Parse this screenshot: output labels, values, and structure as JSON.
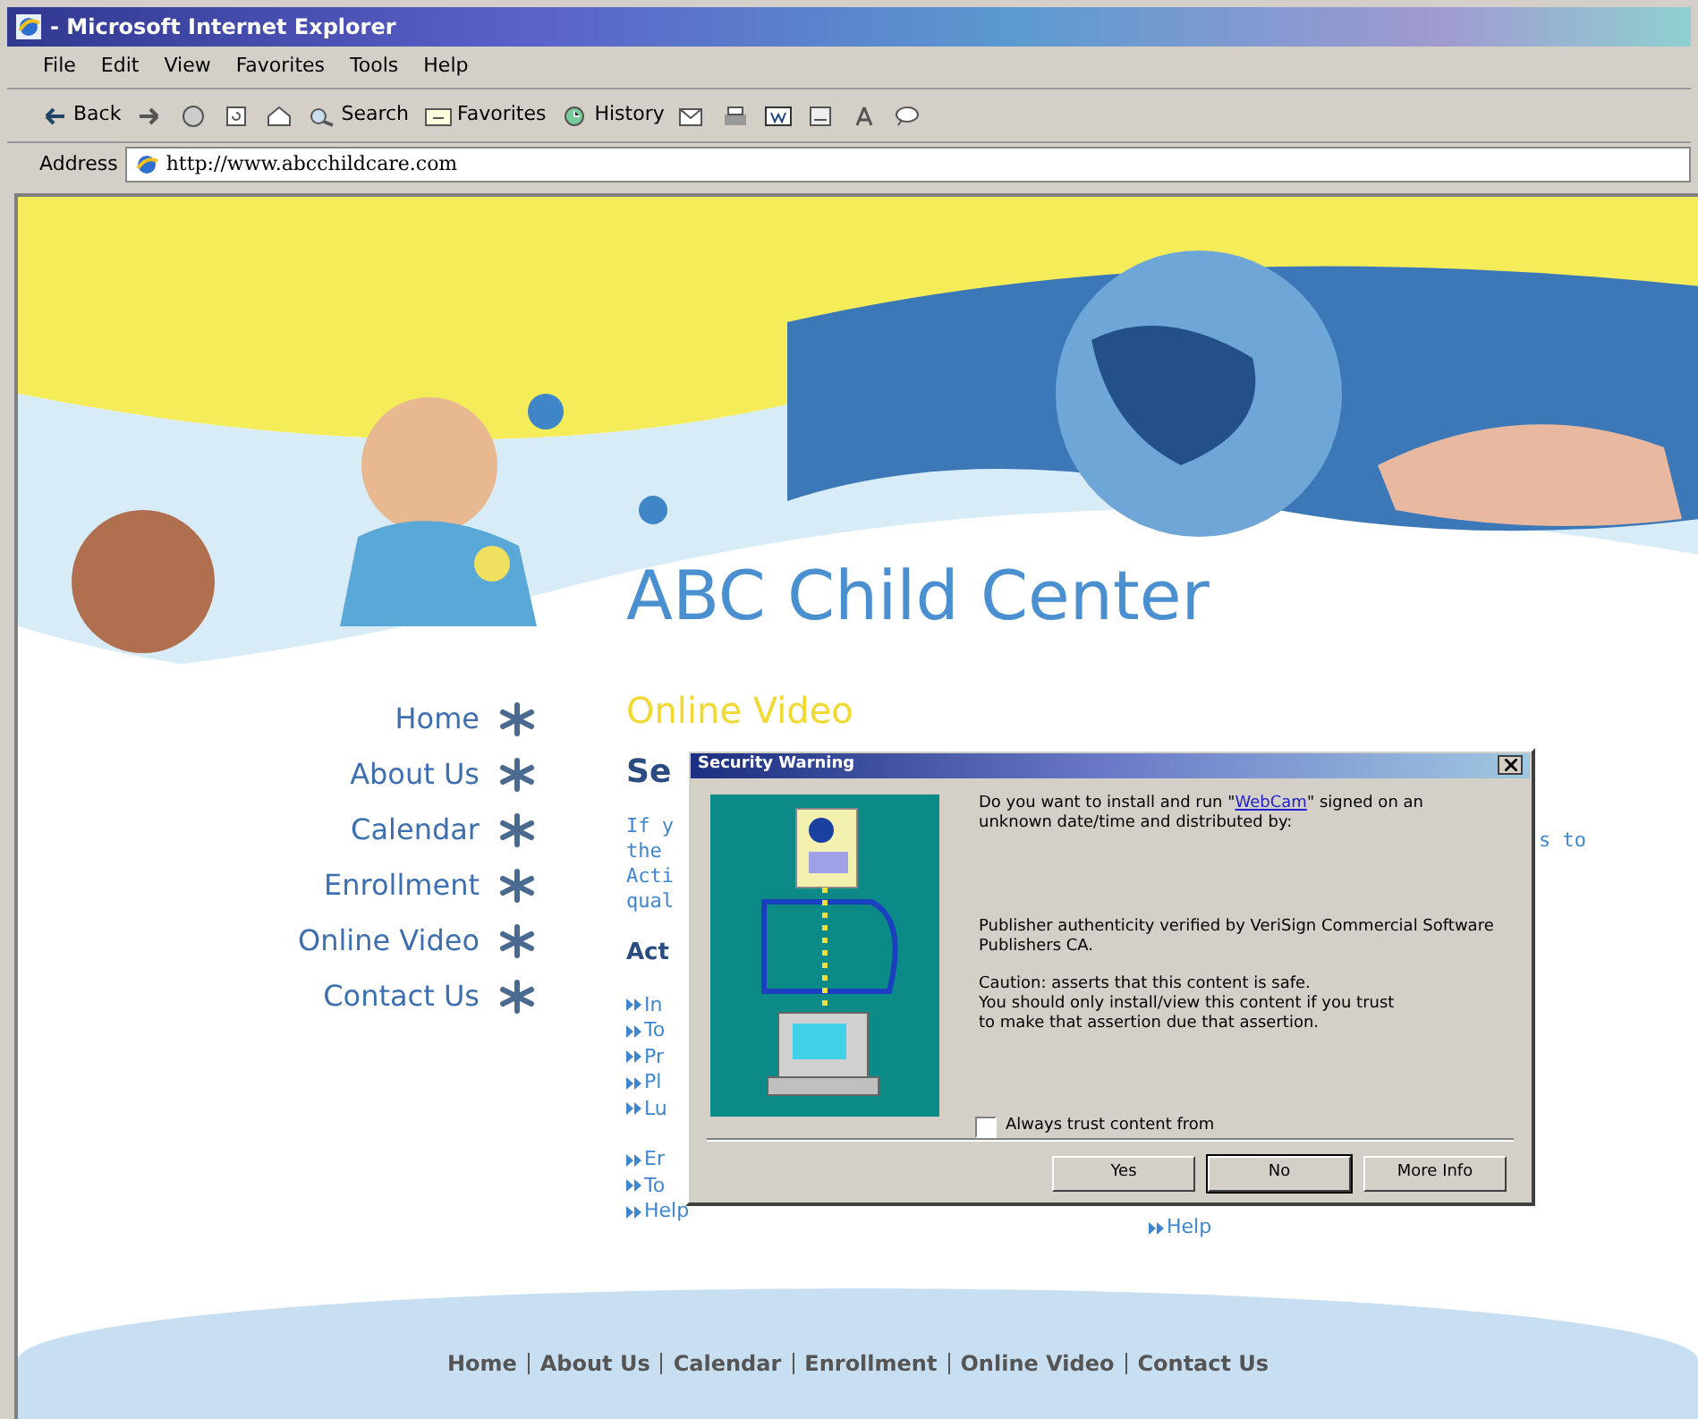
{
  "window": {
    "title": "- Microsoft Internet Explorer"
  },
  "menu": [
    "File",
    "Edit",
    "View",
    "Favorites",
    "Tools",
    "Help"
  ],
  "toolbar": [
    {
      "kind": "back",
      "label": "Back"
    },
    {
      "kind": "forward"
    },
    {
      "kind": "stop"
    },
    {
      "kind": "refresh"
    },
    {
      "kind": "home"
    },
    {
      "kind": "search",
      "label": "Search"
    },
    {
      "kind": "favorites",
      "label": "Favorites"
    },
    {
      "kind": "history",
      "label": "History"
    },
    {
      "kind": "mail"
    },
    {
      "kind": "print"
    },
    {
      "kind": "edit"
    },
    {
      "kind": "discuss"
    },
    {
      "kind": "messenger"
    },
    {
      "kind": "chat"
    }
  ],
  "address": {
    "label": "Address",
    "value": "http://www.abcchildcare.com"
  },
  "site": {
    "title": "ABC Child Center",
    "nav": [
      "Home",
      "About Us",
      "Calendar",
      "Enrollment",
      "Online Video",
      "Contact Us"
    ],
    "section_title": "Online Video",
    "heading": "Se",
    "paragraph": [
      "If y",
      "the",
      "Acti",
      "qual"
    ],
    "paragraph_right": "s to",
    "subheading": "Act",
    "links_1": [
      "In",
      "To",
      "Pr",
      "Pl",
      "Lu"
    ],
    "links_2": [
      "Er",
      "To",
      "Help"
    ],
    "link_right": "Help",
    "footer": [
      "Home",
      "About Us",
      "Calendar",
      "Enrollment",
      "Online Video",
      "Contact Us"
    ]
  },
  "dialog": {
    "title": "Security Warning",
    "question_before": "Do you want to install and run \"",
    "link": "WebCam",
    "question_after": "\" signed on an unknown date/time and distributed by:",
    "publisher": "Publisher authenticity verified by VeriSign Commercial Software Publishers CA.",
    "caution": [
      "Caution: asserts that this content is safe.",
      "You should only install/view this content if you trust",
      "to make that assertion due that assertion."
    ],
    "checkbox": {
      "label": "Always trust content from",
      "checked": false
    },
    "buttons": [
      {
        "label": "Yes",
        "selected": false
      },
      {
        "label": "No",
        "selected": true
      },
      {
        "label": "More Info",
        "selected": false
      }
    ]
  }
}
